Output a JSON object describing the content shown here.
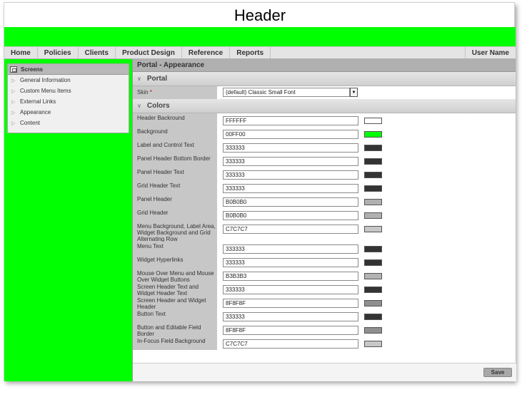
{
  "header": {
    "title": "Header"
  },
  "nav": {
    "items": [
      "Home",
      "Policies",
      "Clients",
      "Product Design",
      "Reference",
      "Reports"
    ],
    "user": "User Name"
  },
  "sidebar": {
    "title": "Screens",
    "items": [
      {
        "label": "General Information"
      },
      {
        "label": "Custom Menu Items"
      },
      {
        "label": "External Links"
      },
      {
        "label": "Appearance"
      },
      {
        "label": "Content"
      }
    ]
  },
  "main": {
    "title": "Portal - Appearance",
    "portal_section": "Portal",
    "skin_label": "Skin",
    "skin_required": "*",
    "skin_value": "(default) Classic Small Font",
    "colors_section": "Colors",
    "colors": [
      {
        "label": "Header Backround",
        "value": "FFFFFF",
        "swatch": "#FFFFFF"
      },
      {
        "label": "Background",
        "value": "00FF00",
        "swatch": "#00FF00"
      },
      {
        "label": "Label and Control Text",
        "value": "333333",
        "swatch": "#333333"
      },
      {
        "label": "Panel Header Bottom Border",
        "value": "333333",
        "swatch": "#333333"
      },
      {
        "label": "Panel Header Text",
        "value": "333333",
        "swatch": "#333333"
      },
      {
        "label": "Grid Header Text",
        "value": "333333",
        "swatch": "#333333"
      },
      {
        "label": "Panel Header",
        "value": "B0B0B0",
        "swatch": "#B0B0B0"
      },
      {
        "label": "Grid Header",
        "value": "B0B0B0",
        "swatch": "#B0B0B0"
      },
      {
        "label": "Menu Background, Label Area, Widget Background and Grid Alternating Row",
        "value": "C7C7C7",
        "swatch": "#C7C7C7"
      },
      {
        "label": "Menu Text",
        "value": "333333",
        "swatch": "#333333"
      },
      {
        "label": "Widget Hyperlinks",
        "value": "333333",
        "swatch": "#333333"
      },
      {
        "label": "Mouse Over Menu and Mouse Over Widget Buttons",
        "value": "B3B3B3",
        "swatch": "#B3B3B3"
      },
      {
        "label": "Screen Header Text and Widget Header Text",
        "value": "333333",
        "swatch": "#333333"
      },
      {
        "label": "Screen Header and Widget Header",
        "value": "8F8F8F",
        "swatch": "#8F8F8F"
      },
      {
        "label": "Button Text",
        "value": "333333",
        "swatch": "#333333"
      },
      {
        "label": "Button and Editable Field Border",
        "value": "8F8F8F",
        "swatch": "#8F8F8F"
      },
      {
        "label": "In-Focus Field Background",
        "value": "C7C7C7",
        "swatch": "#C7C7C7"
      }
    ],
    "save_label": "Save"
  }
}
